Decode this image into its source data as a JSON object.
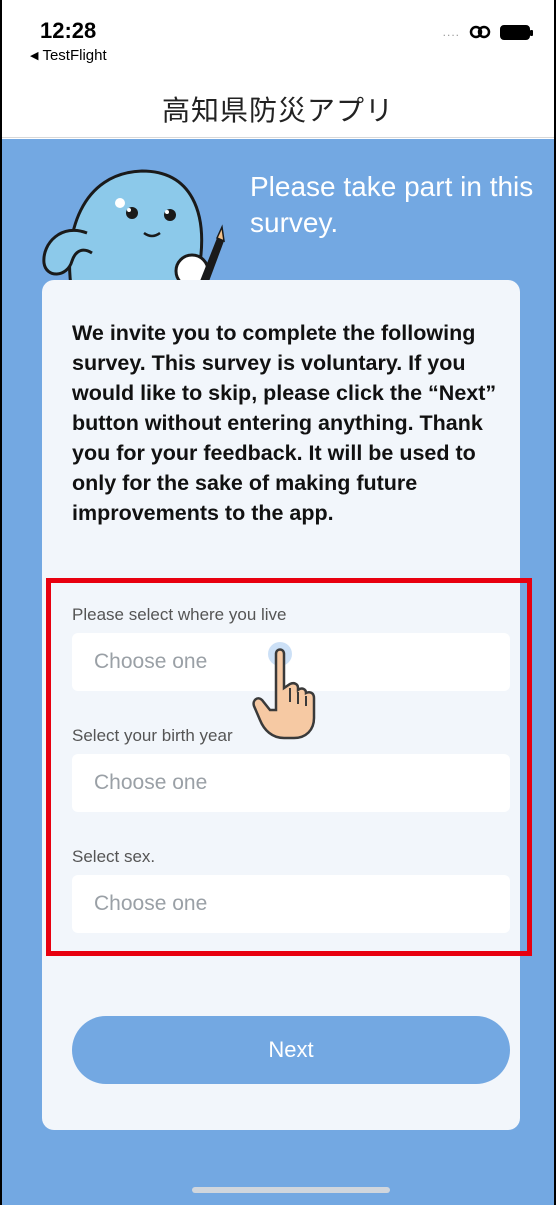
{
  "status_bar": {
    "time": "12:28",
    "back_label": "TestFlight",
    "signal_dots": "....",
    "icons": [
      "link-icon",
      "battery-icon"
    ]
  },
  "header": {
    "title": "高知県防災アプリ"
  },
  "main": {
    "headline": "Please take part in this survey.",
    "intro": "We invite you to complete the following survey. This survey is voluntary. If you would like to skip, please click the “Next” button without entering anything. Thank you for your feedback. It will be used to only for the sake of making future improvements to the app.",
    "fields": [
      {
        "label": "Please select where you live",
        "placeholder": "Choose one"
      },
      {
        "label": "Select your birth year",
        "placeholder": "Choose one"
      },
      {
        "label": "Select sex.",
        "placeholder": "Choose one"
      }
    ],
    "next_label": "Next"
  },
  "colors": {
    "primary_blue": "#73a8e2",
    "card_bg": "#f2f6fb",
    "highlight_red": "#e8000f"
  }
}
